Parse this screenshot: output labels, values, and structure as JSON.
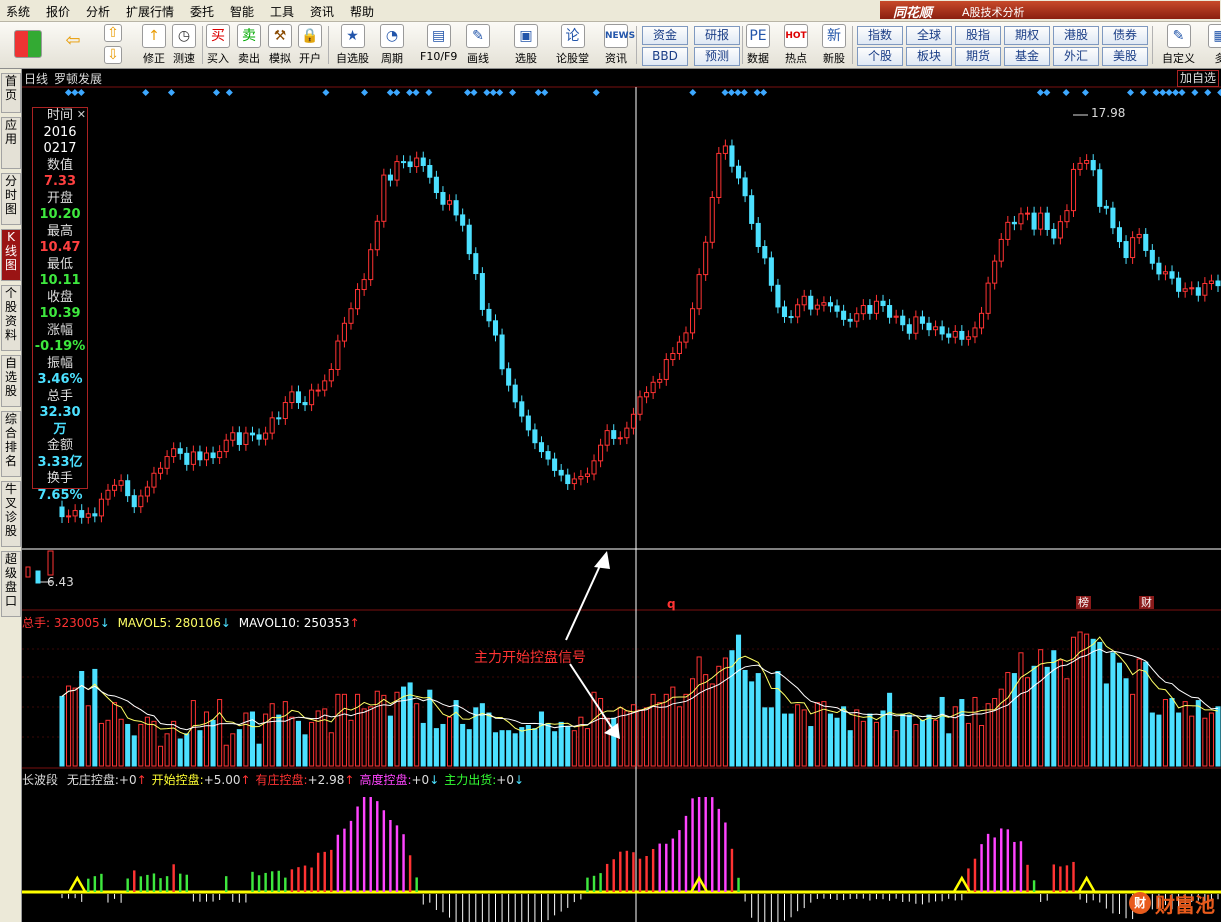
{
  "menu": [
    "系统",
    "报价",
    "分析",
    "扩展行情",
    "委托",
    "智能",
    "工具",
    "资讯",
    "帮助"
  ],
  "brand": {
    "name": "同花顺",
    "subtitle": "A股技术分析"
  },
  "toolbar": {
    "buttons": [
      {
        "label": "修正",
        "icon": "↑",
        "color": "#e89a00"
      },
      {
        "label": "测速",
        "icon": "◷",
        "color": "#333"
      },
      {
        "label": "买入",
        "icon": "买",
        "color": "#d00"
      },
      {
        "label": "卖出",
        "icon": "卖",
        "color": "#0a0"
      },
      {
        "label": "模拟",
        "icon": "⚒",
        "color": "#8a4a00"
      },
      {
        "label": "开户",
        "icon": "🔒",
        "color": "#8a6a00"
      },
      {
        "label": "自选股",
        "icon": "★",
        "color": "#2255aa"
      },
      {
        "label": "周期",
        "icon": "◔",
        "color": "#2255aa"
      },
      {
        "label": "F10/F9",
        "icon": "▤",
        "color": "#2255aa"
      },
      {
        "label": "画线",
        "icon": "✎",
        "color": "#2255aa"
      },
      {
        "label": "选股",
        "icon": "▣",
        "color": "#2255aa"
      },
      {
        "label": "论股堂",
        "icon": "论",
        "color": "#2255aa"
      },
      {
        "label": "资讯",
        "icon": "NEWS",
        "color": "#2255aa"
      },
      {
        "label": "数据",
        "icon": "PE",
        "color": "#2255aa"
      },
      {
        "label": "热点",
        "icon": "HOT",
        "color": "#d00"
      },
      {
        "label": "新股",
        "icon": "新",
        "color": "#2255aa"
      },
      {
        "label": "自定义",
        "icon": "✎",
        "color": "#2255aa"
      },
      {
        "label": "多",
        "icon": "▦",
        "color": "#2255aa"
      }
    ],
    "grid_a": [
      "资金",
      "研报",
      "BBD",
      "预测"
    ],
    "grid_b": [
      "指数",
      "全球",
      "股指",
      "期权",
      "港股",
      "债券",
      "个股",
      "板块",
      "期货",
      "基金",
      "外汇",
      "美股"
    ]
  },
  "left_tabs": [
    "首页",
    "应用",
    "分时图",
    "K线图",
    "个股资料",
    "自选股",
    "综合排名",
    "牛叉诊股",
    "超级盘口"
  ],
  "chart_header": {
    "period": "日线",
    "stock_name": "罗顿发展",
    "add_favorite": "加自选"
  },
  "info_panel": {
    "time_label": "时间",
    "date_year": "2016",
    "date_md": "0217",
    "value_label": "数值",
    "value": "7.33",
    "open_label": "开盘",
    "open": "10.20",
    "high_label": "最高",
    "high": "10.47",
    "low_label": "最低",
    "low": "10.11",
    "close_label": "收盘",
    "close": "10.39",
    "change_label": "涨幅",
    "change": "-0.19%",
    "amplitude_label": "振幅",
    "amplitude": "3.46%",
    "volume_label": "总手",
    "volume": "32.30万",
    "amount_label": "金额",
    "amount": "3.33亿",
    "turnover_label": "换手",
    "turnover": "7.65%"
  },
  "annotations": {
    "price_high": "17.98",
    "price_low": "6.43",
    "signal_text": "主力开始控盘信号",
    "tag_bang": "榜",
    "tag_cai": "财",
    "tag_q": "q"
  },
  "volume_header": {
    "total_label": "总手:",
    "total": "323005",
    "ma5_label": "MAVOL5:",
    "ma5": "280106",
    "ma10_label": "MAVOL10:",
    "ma10": "250353"
  },
  "indicator_header": {
    "name": "长波段",
    "items": [
      {
        "label": "无庄控盘:",
        "value": "+0",
        "arrow": "↑",
        "color": "#dddddd"
      },
      {
        "label": "开始控盘:",
        "value": "+5.00",
        "arrow": "↑",
        "color": "#ffff33"
      },
      {
        "label": "有庄控盘:",
        "value": "+2.98",
        "arrow": "↑",
        "color": "#ff3333"
      },
      {
        "label": "高度控盘:",
        "value": "+0",
        "arrow": "↓",
        "color": "#ff44ff"
      },
      {
        "label": "主力出货:",
        "value": "+0",
        "arrow": "↓",
        "color": "#33ff33"
      }
    ]
  },
  "watermark": {
    "text": "财富池",
    "badge": "财"
  },
  "colors": {
    "up": "#ff3333",
    "down": "#4ce0ff",
    "grid": "#7a1010",
    "ma5": "#ffff66",
    "ma10": "#ffffff",
    "signal": "#ffff00"
  },
  "chart_data": {
    "type": "candlestick",
    "open": [
      7.2,
      6.93,
      6.95,
      7.1,
      6.91,
      7.01,
      6.95,
      7.42,
      7.67,
      7.81,
      7.94,
      7.52,
      7.21,
      7.51,
      7.76,
      8.15,
      8.29,
      8.62,
      8.84,
      8.71,
      8.4,
      8.75,
      8.53,
      8.72,
      8.59,
      8.76,
      9.08,
      9.29,
      8.96,
      9.28,
      9.23,
      9.11,
      9.28,
      9.71,
      9.69,
      10.14,
      10.44,
      10.14,
      10.08,
      10.49,
      10.49,
      10.75,
      11.07,
      11.87,
      12.37,
      12.78,
      13.32,
      13.6,
      14.44,
      15.24,
      16.54,
      16.4,
      16.92,
      16.91,
      16.78,
      17.02,
      16.81,
      16.48,
      16.05,
      15.72,
      15.82,
      15.42,
      15.13,
      14.33,
      13.77,
      12.76,
      12.44,
      12.04,
      11.09,
      10.63,
      10.16,
      9.76,
      9.37,
      9.01,
      8.76,
      8.55,
      8.23,
      8.1,
      7.86,
      7.99,
      8.06,
      8.13,
      8.5,
      8.94,
      9.35,
      9.13,
      9.15,
      9.42,
      9.81,
      10.3,
      10.42,
      10.71,
      10.79,
      11.35,
      11.52,
      11.84,
      12.1,
      12.78,
      13.74,
      14.65,
      15.91,
      17.15,
      17.36,
      16.79,
      16.46,
      15.96,
      15.18,
      14.53,
      14.21,
      13.44,
      12.83,
      12.56,
      12.55,
      12.89,
      13.13,
      12.77,
      12.88,
      12.95,
      12.86,
      12.71,
      12.48,
      12.43,
      12.64,
      12.87,
      12.65,
      12.99,
      12.87,
      12.54,
      12.57,
      12.33,
      12.09,
      12.55,
      12.37,
      12.19,
      12.27,
      12.07,
      11.98,
      12.14,
      11.92,
      11.99,
      12.24,
      12.65,
      13.5,
      14.12,
      14.73,
      15.21,
      15.17,
      15.45,
      15.47,
      15.02,
      15.47,
      15.01,
      14.77,
      15.23,
      15.54,
      16.7,
      16.87,
      16.95,
      16.69,
      15.66,
      15.61,
      15.06,
      14.67,
      14.22,
      14.78,
      14.87,
      14.42,
      14.06,
      13.76,
      13.82,
      13.64,
      13.27,
      13.34,
      13.37,
      13.16,
      13.49,
      13.56
    ],
    "close": [
      6.93,
      6.95,
      7.1,
      6.91,
      7.01,
      6.95,
      7.42,
      7.67,
      7.81,
      7.94,
      7.52,
      7.21,
      7.51,
      7.76,
      8.15,
      8.29,
      8.62,
      8.84,
      8.71,
      8.4,
      8.75,
      8.53,
      8.72,
      8.59,
      8.76,
      9.08,
      9.29,
      8.96,
      9.28,
      9.23,
      9.11,
      9.28,
      9.71,
      9.69,
      10.14,
      10.44,
      10.14,
      10.08,
      10.49,
      10.49,
      10.75,
      11.07,
      11.87,
      12.37,
      12.78,
      13.32,
      13.6,
      14.44,
      15.24,
      16.54,
      16.4,
      16.92,
      16.91,
      16.78,
      17.02,
      16.81,
      16.48,
      16.05,
      15.72,
      15.82,
      15.42,
      15.13,
      14.33,
      13.77,
      12.76,
      12.44,
      12.04,
      11.09,
      10.63,
      10.16,
      9.76,
      9.37,
      9.01,
      8.76,
      8.55,
      8.23,
      8.1,
      7.86,
      7.99,
      8.06,
      8.13,
      8.5,
      8.94,
      9.35,
      9.13,
      9.15,
      9.42,
      9.81,
      10.3,
      10.42,
      10.71,
      10.79,
      11.35,
      11.52,
      11.84,
      12.1,
      12.78,
      13.74,
      14.65,
      15.91,
      17.15,
      17.36,
      16.79,
      16.46,
      15.96,
      15.18,
      14.53,
      14.21,
      13.44,
      12.83,
      12.56,
      12.55,
      12.89,
      13.13,
      12.77,
      12.88,
      12.95,
      12.86,
      12.71,
      12.48,
      12.43,
      12.64,
      12.87,
      12.65,
      12.99,
      12.87,
      12.54,
      12.57,
      12.33,
      12.09,
      12.55,
      12.37,
      12.19,
      12.27,
      12.07,
      11.98,
      12.14,
      11.92,
      11.99,
      12.24,
      12.65,
      13.5,
      14.12,
      14.73,
      15.21,
      15.17,
      15.45,
      15.47,
      15.02,
      15.47,
      15.01,
      14.77,
      15.23,
      15.54,
      16.7,
      16.87,
      16.95,
      16.69,
      15.66,
      15.61,
      15.06,
      14.67,
      14.22,
      14.78,
      14.87,
      14.42,
      14.06,
      13.76,
      13.82,
      13.64,
      13.27,
      13.34,
      13.37,
      13.16,
      13.49,
      13.56,
      13.43
    ],
    "volume": [
      67,
      77,
      75,
      91,
      58,
      93,
      41,
      44,
      61,
      45,
      40,
      29,
      40,
      47,
      43,
      19,
      31,
      43,
      26,
      31,
      63,
      34,
      52,
      44,
      64,
      20,
      31,
      35,
      51,
      52,
      21,
      50,
      60,
      49,
      62,
      47,
      43,
      30,
      42,
      53,
      55,
      32,
      69,
      69,
      44,
      69,
      55,
      57,
      72,
      68,
      48,
      71,
      76,
      80,
      60,
      41,
      73,
      36,
      40,
      47,
      63,
      40,
      35,
      56,
      60,
      51,
      32,
      34,
      34,
      31,
      37,
      39,
      36,
      52,
      41,
      33,
      42,
      38,
      34,
      47,
      36,
      71,
      65,
      46,
      46,
      56,
      53,
      59,
      54,
      56,
      69,
      61,
      69,
      76,
      57,
      69,
      84,
      105,
      88,
      79,
      96,
      104,
      111,
      126,
      92,
      81,
      89,
      56,
      56,
      91,
      50,
      50,
      59,
      54,
      38,
      61,
      62,
      50,
      46,
      57,
      34,
      54,
      43,
      50,
      42,
      53,
      70,
      34,
      50,
      49,
      40,
      44,
      49,
      44,
      66,
      31,
      57,
      64,
      41,
      66,
      39,
      60,
      65,
      74,
      90,
      89,
      109,
      85,
      96,
      112,
      95,
      111,
      102,
      84,
      124,
      129,
      127,
      122,
      119,
      79,
      109,
      99,
      84,
      69,
      103,
      100,
      51,
      49,
      64,
      65,
      51,
      62,
      48,
      63,
      46,
      51,
      57,
      61
    ],
    "price_high": "17.98",
    "price_low": "6.43",
    "indicator": {
      "name": "长波段",
      "series": [
        "无庄控盘",
        "开始控盘",
        "有庄控盘",
        "高度控盘",
        "主力出货"
      ]
    }
  }
}
